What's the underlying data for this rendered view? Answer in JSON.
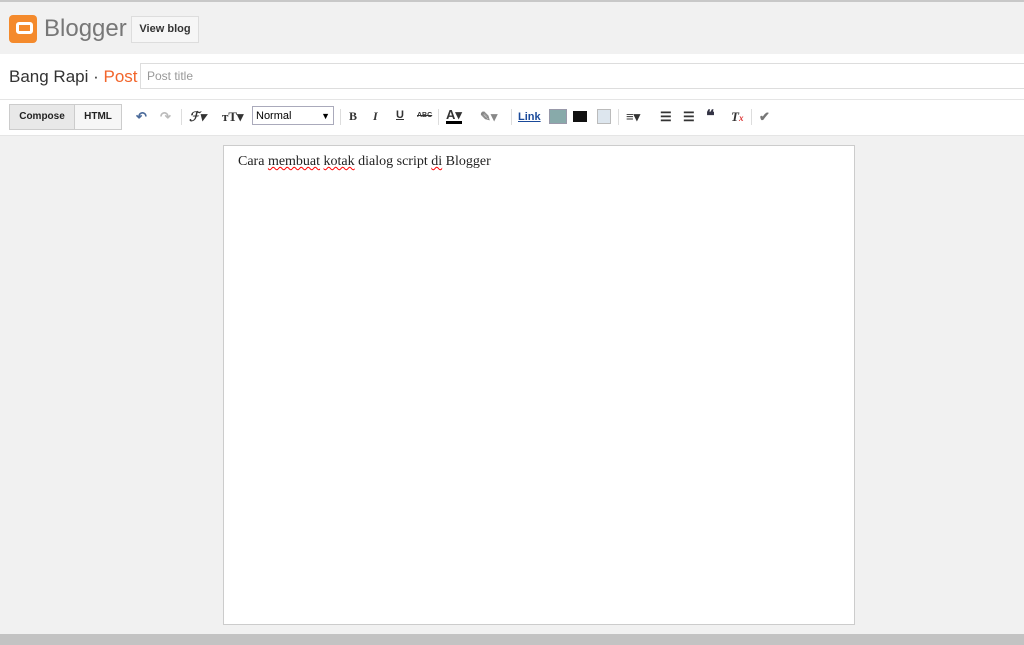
{
  "header": {
    "brand": "Blogger",
    "view_blog": "View blog"
  },
  "post_bar": {
    "blog_name": "Bang Rapi",
    "sep": " · ",
    "section": "Post",
    "title_placeholder": "Post title"
  },
  "toolbar": {
    "compose": "Compose",
    "html": "HTML",
    "format": "Normal",
    "link": "Link"
  },
  "editor": {
    "w1": "Cara ",
    "w2": "membuat",
    "w3": " ",
    "w4": "kotak",
    "w5": " dialog script ",
    "w6": "di",
    "w7": " Blogger"
  },
  "colors": {
    "accent": "#f2652b",
    "logo": "#f48a2c"
  }
}
